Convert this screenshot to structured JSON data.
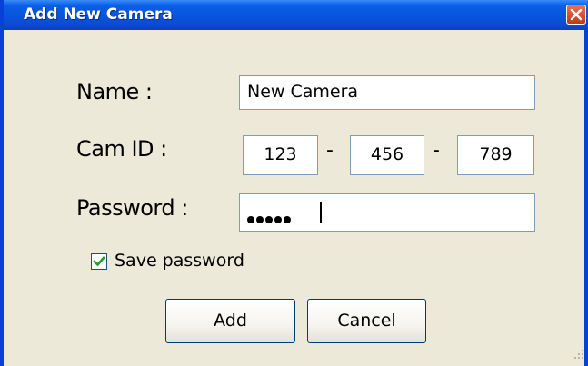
{
  "window": {
    "title": "Add New Camera"
  },
  "form": {
    "name_label": "Name :",
    "name_value": "New Camera",
    "cam_id_label": "Cam ID :",
    "cam_id_parts": [
      "123",
      "456",
      "789"
    ],
    "cam_id_separator": "-",
    "password_label": "Password :",
    "password_mask_length": 5,
    "save_password_label": "Save password",
    "save_password_checked": true
  },
  "buttons": {
    "add_label": "Add",
    "cancel_label": "Cancel"
  },
  "colors": {
    "title_bar": "#0854dc",
    "window_bg": "#ece9d8",
    "close_button": "#d9522f",
    "checkmark": "#21a121"
  },
  "icons": {
    "close": "close-icon",
    "checkbox": "checkmark-icon",
    "resize": "resize-grip-icon"
  }
}
